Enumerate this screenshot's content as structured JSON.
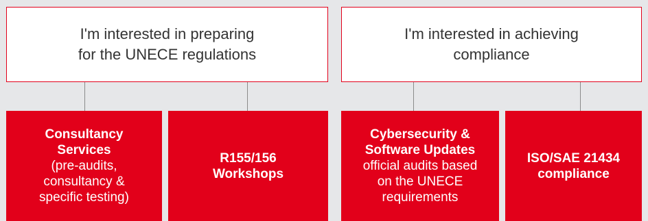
{
  "left_box": {
    "lines": [
      "I'm interested in preparing",
      "for the UNECE regulations"
    ]
  },
  "right_box": {
    "lines": [
      "I'm interested in achieving",
      "compliance"
    ]
  },
  "cards": [
    {
      "bold": [
        "Consultancy",
        "Services"
      ],
      "normal": [
        "(pre-audits,",
        "consultancy &",
        "specific testing)"
      ]
    },
    {
      "bold": [
        "R155/156",
        "Workshops"
      ],
      "normal": []
    },
    {
      "bold": [
        "Cybersecurity &",
        "Software Updates"
      ],
      "normal": [
        "official audits based",
        "on the UNECE",
        "requirements"
      ]
    },
    {
      "bold": [
        "ISO/SAE 21434",
        "compliance"
      ],
      "normal": []
    }
  ],
  "colors": {
    "accent": "#e2001a",
    "page_bg": "#e6e7e9",
    "box_text": "#333333",
    "connector": "#8a8a8a"
  }
}
